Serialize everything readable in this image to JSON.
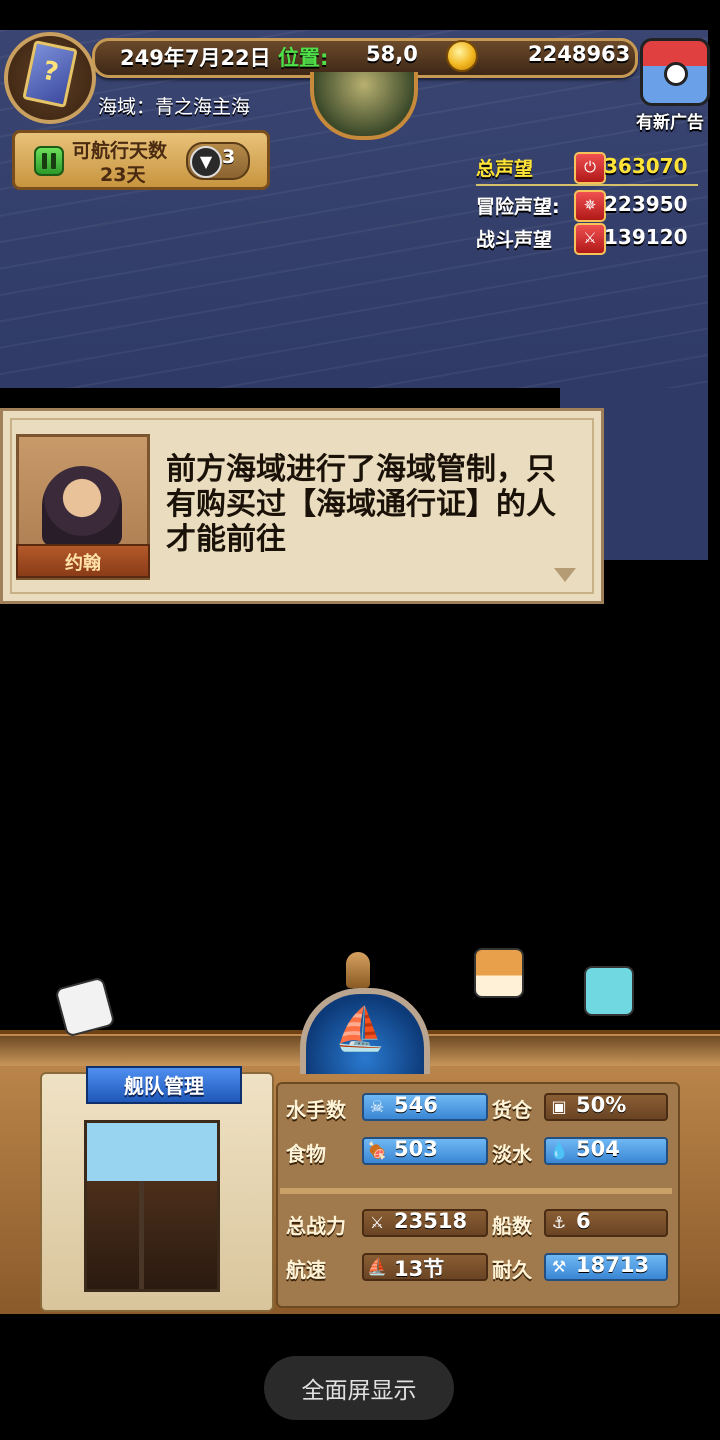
{
  "header": {
    "date": "249年7月22日",
    "position_label": "位置:",
    "position_value": "58,0",
    "gold": "2248963",
    "sea_zone": "海域：青之海主海",
    "ad_label": "有新广告",
    "book_symbol": "?"
  },
  "sail": {
    "label": "可航行天数",
    "days": "23天",
    "down_count": "3",
    "down_symbol": "▼"
  },
  "reputation": {
    "total_label": "总声望",
    "total_value": "363070",
    "adventure_label": "冒险声望:",
    "adventure_value": "223950",
    "battle_label": "战斗声望",
    "battle_value": "139120",
    "total_color": "#ffe437"
  },
  "dialog": {
    "speaker": "约翰",
    "text": "前方海域进行了海域管制，只有购买过【海域通行证】的人才能前往"
  },
  "fleet": {
    "title": "舰队管理",
    "ship_symbol": "⛵",
    "stats": [
      {
        "label": "水手数",
        "value": "546",
        "icon": "sailor-icon",
        "glyph": "☠"
      },
      {
        "label": "货仓",
        "value": "50%",
        "icon": "cargo-icon",
        "glyph": "▣"
      },
      {
        "label": "食物",
        "value": "503",
        "icon": "meat-icon",
        "glyph": "🍖"
      },
      {
        "label": "淡水",
        "value": "504",
        "icon": "water-icon",
        "glyph": "💧"
      },
      {
        "label": "总战力",
        "value": "23518",
        "icon": "sword-icon",
        "glyph": "⚔"
      },
      {
        "label": "船数",
        "value": "6",
        "icon": "ship-count-icon",
        "glyph": "⚓"
      },
      {
        "label": "航速",
        "value": "13节",
        "icon": "speed-icon",
        "glyph": "⛵"
      },
      {
        "label": "耐久",
        "value": "18713",
        "icon": "durability-icon",
        "glyph": "⚒"
      }
    ]
  },
  "footer": {
    "fullscreen_label": "全面屏显示"
  }
}
